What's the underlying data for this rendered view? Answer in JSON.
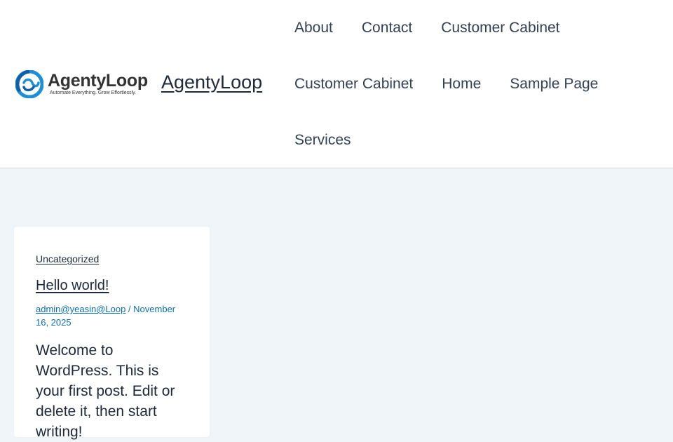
{
  "brand": {
    "logo_word": "AgentyLoop",
    "logo_tagline": "Automate Everything. Grow Effortlessly.",
    "site_title": "AgentyLoop",
    "colors": {
      "logo_blue": "#1d8fd6",
      "logo_dark": "#333333"
    }
  },
  "nav": {
    "rows": [
      [
        "About",
        "Contact",
        "Customer Cabinet"
      ],
      [
        "Customer Cabinet",
        "Home",
        "Sample Page"
      ],
      [
        "Services"
      ]
    ]
  },
  "post": {
    "category": "Uncategorized",
    "title": "Hello world!",
    "author": "admin@yeasin@Loop",
    "separator": " / ",
    "date": "November 16, 2025",
    "excerpt": "Welcome to WordPress. This is your first post. Edit or delete it, then start writing!"
  },
  "colors": {
    "page_bg": "#f0f5fa",
    "header_bg": "#ffffff",
    "text": "#1e293b",
    "link_meta": "#0a6fb5"
  }
}
